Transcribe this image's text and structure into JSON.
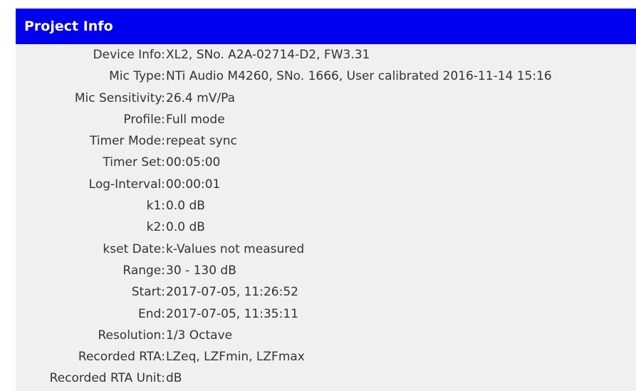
{
  "header": {
    "title": "Project Info",
    "background_color": "#0000ee",
    "title_color": "#ffffff"
  },
  "rows": [
    {
      "label": "Device Info:",
      "value": "XL2, SNo. A2A-02714-D2, FW3.31"
    },
    {
      "label": "Mic Type:",
      "value": "NTi Audio M4260, SNo. 1666, User calibrated 2016-11-14  15:16"
    },
    {
      "label": "Mic Sensitivity:",
      "value": "26.4 mV/Pa"
    },
    {
      "label": "Profile:",
      "value": "Full mode"
    },
    {
      "label": "Timer Mode:",
      "value": "repeat sync"
    },
    {
      "label": "Timer Set:",
      "value": "00:05:00"
    },
    {
      "label": "Log-Interval:",
      "value": "00:00:01"
    },
    {
      "label": "k1:",
      "value": "0.0 dB"
    },
    {
      "label": "k2:",
      "value": "0.0 dB"
    },
    {
      "label": "kset Date:",
      "value": "k-Values not measured"
    },
    {
      "label": "Range:",
      "value": "30 - 130 dB"
    },
    {
      "label": "Start:",
      "value": "2017-07-05, 11:26:52"
    },
    {
      "label": "End:",
      "value": "2017-07-05, 11:35:11"
    },
    {
      "label": "Resolution:",
      "value": "1/3 Octave"
    },
    {
      "label": "Recorded RTA:",
      "value": "LZeq, LZFmin, LZFmax"
    },
    {
      "label": "Recorded RTA Unit:",
      "value": "dB"
    }
  ]
}
